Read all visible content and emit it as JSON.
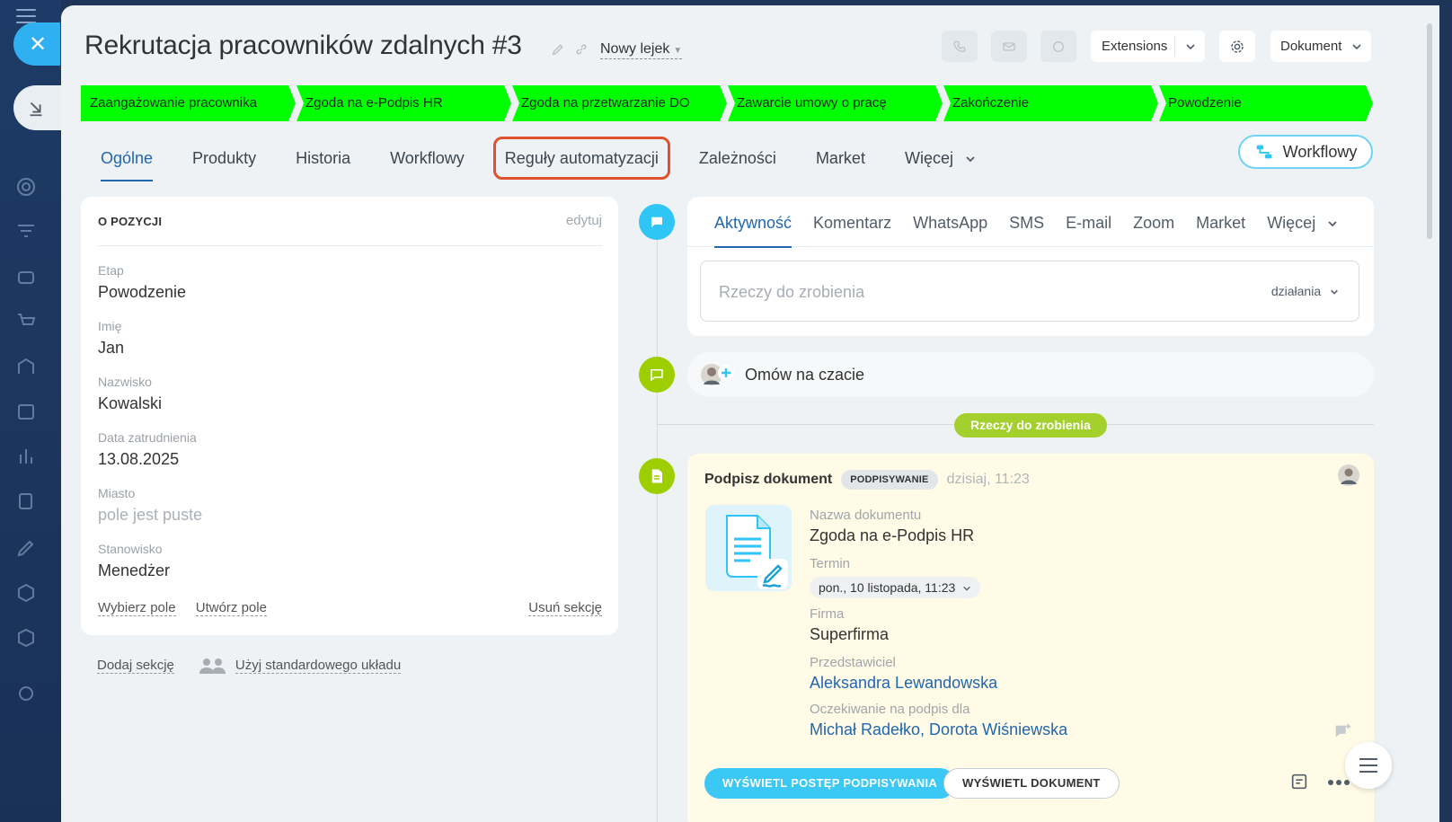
{
  "title": "Rekrutacja pracowników zdalnych #3",
  "funnel_label": "Nowy lejek",
  "header": {
    "extensions_label": "Extensions",
    "document_label": "Dokument"
  },
  "stages": [
    "Zaangażowanie pracownika",
    "Zgoda na e-Podpis HR",
    "Zgoda na przetwarzanie DO",
    "Zawarcie umowy o pracę",
    "Zakończenie",
    "Powodzenie"
  ],
  "stage_color": "#00ff00",
  "tabs": [
    "Ogólne",
    "Produkty",
    "Historia",
    "Workflowy",
    "Reguły automatyzacji",
    "Zależności",
    "Market",
    "Więcej"
  ],
  "workflow_button": "Workflowy",
  "card": {
    "heading": "O POZYCJI",
    "edit": "edytuj",
    "fields": [
      {
        "label": "Etap",
        "value": "Powodzenie"
      },
      {
        "label": "Imię",
        "value": "Jan"
      },
      {
        "label": "Nazwisko",
        "value": "Kowalski"
      },
      {
        "label": "Data zatrudnienia",
        "value": "13.08.2025"
      },
      {
        "label": "Miasto",
        "value": "pole jest puste"
      },
      {
        "label": "Stanowisko",
        "value": "Menedżer"
      }
    ],
    "choose_field": "Wybierz pole",
    "create_field": "Utwórz pole",
    "delete_section": "Usuń sekcję"
  },
  "below_card": {
    "add_section": "Dodaj sekcję",
    "use_default": "Użyj standardowego układu"
  },
  "activity": {
    "tabs": [
      "Aktywność",
      "Komentarz",
      "WhatsApp",
      "SMS",
      "E-mail",
      "Zoom",
      "Market",
      "Więcej"
    ],
    "todo_placeholder": "Rzeczy do zrobienia",
    "actions_label": "działania"
  },
  "chat_label": "Omów na czacie",
  "todo_pill": "Rzeczy do zrobienia",
  "doc": {
    "title": "Podpisz dokument",
    "badge": "PODPISYWANIE",
    "time": "dzisiaj, 11:23",
    "name_label": "Nazwa dokumentu",
    "name_value": "Zgoda na e-Podpis HR",
    "term_label": "Termin",
    "term_value": "pon., 10 listopada, 11:23",
    "company_label": "Firma",
    "company_value": "Superfirma",
    "rep_label": "Przedstawiciel",
    "rep_value": "Aleksandra Lewandowska",
    "waiting_label": "Oczekiwanie na podpis dla",
    "waiting_value": "Michał Radełko, Dorota Wiśniewska",
    "btn_progress": "WYŚWIETL POSTĘP PODPISYWANIA",
    "btn_document": "WYŚWIETL DOKUMENT"
  },
  "colors": {
    "accent": "#2067b0",
    "highlight": "#e0512e",
    "timeline_blue": "#2fc6f6",
    "timeline_green": "#9dcf00"
  }
}
